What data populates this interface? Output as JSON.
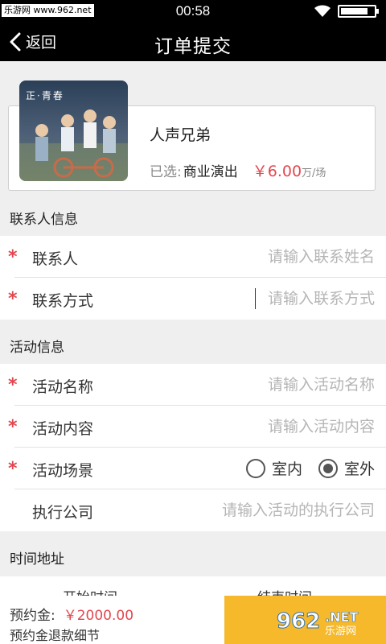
{
  "status_bar": {
    "watermark": "乐游网 www.962.net",
    "time": "00:58",
    "battery_level": 0.85,
    "icons": [
      "wifi-icon",
      "battery-icon"
    ]
  },
  "nav": {
    "back_label": "返回",
    "title": "订单提交",
    "back_icon": "chevron-left-icon"
  },
  "product": {
    "poster_title": "正·青春",
    "name": "人声兄弟",
    "selected_label": "已选:",
    "selected_value": "商业演出",
    "price": "￥6.00",
    "unit": "万/场"
  },
  "contact_section": {
    "title": "联系人信息",
    "fields": [
      {
        "label": "联系人",
        "placeholder": "请输入联系姓名",
        "required": true
      },
      {
        "label": "联系方式",
        "placeholder": "请输入联系方式",
        "required": true
      }
    ]
  },
  "activity_section": {
    "title": "活动信息",
    "fields": [
      {
        "label": "活动名称",
        "placeholder": "请输入活动名称",
        "required": true
      },
      {
        "label": "活动内容",
        "placeholder": "请输入活动内容",
        "required": true
      }
    ],
    "scene": {
      "label": "活动场景",
      "options": [
        "室内",
        "室外"
      ],
      "selected": "室外"
    },
    "company": {
      "label": "执行公司",
      "placeholder": "请输入活动的执行公司",
      "required": false
    }
  },
  "time_section": {
    "title": "时间地址",
    "start_label": "开始时间",
    "end_label": "结束时间"
  },
  "footer": {
    "deposit_label": "预约金:",
    "deposit_amount": "￥2000.00",
    "refund_label": "预约金退款细节"
  },
  "colors": {
    "accent_red": "#e2474f",
    "submit_bg": "#f6b92b",
    "bar_bg": "#000000"
  },
  "watermark_br": "962.NET 乐游网"
}
